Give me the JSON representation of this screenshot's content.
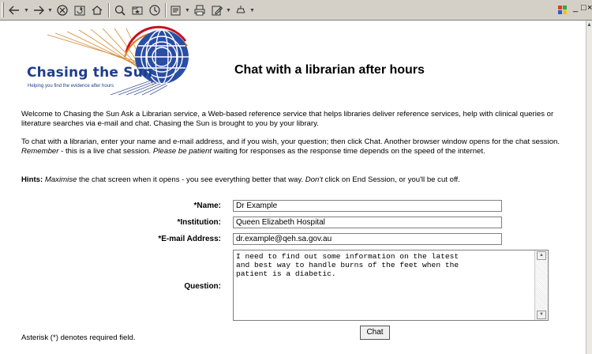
{
  "toolbar": {
    "icons": [
      "back-icon",
      "forward-icon",
      "stop-icon",
      "refresh-icon",
      "home-icon",
      "search-icon",
      "favorites-icon",
      "history-icon",
      "mail-icon",
      "print-icon",
      "edit-icon",
      "discuss-icon"
    ],
    "window_controls": [
      "_",
      "□",
      "×"
    ]
  },
  "logo": {
    "title": "Chasing the Sun",
    "tagline": "Helping you find the evidence after hours"
  },
  "page_title": "Chat with a librarian after hours",
  "intro": {
    "p1": "Welcome to Chasing the Sun Ask a Librarian service, a Web-based reference service that helps libraries deliver reference services, help with clinical queries or literature searches via e-mail and chat. Chasing the Sun is brought to you by your library.",
    "p2_a": "To chat with a librarian, enter your name and e-mail address, and if you wish, your question; then click Chat. Another browser window opens for the chat session. ",
    "p2_remember": "Remember",
    "p2_b": " - this is a live chat session. ",
    "p2_patient": "Please be patient",
    "p2_c": " waiting for responses as the response time depends on the speed of the internet."
  },
  "hints": {
    "label": "Hints:",
    "maximise": "Maximise",
    "text_a": " the chat screen when it opens - you see everything better that way. ",
    "dont": "Don't",
    "text_b": " click on End Session, or you'll be cut off."
  },
  "form": {
    "name_label": "*Name:",
    "name_value": "Dr Example",
    "institution_label": "*Institution:",
    "institution_value": "Queen Elizabeth Hospital",
    "email_label": "*E-mail Address:",
    "email_value": "dr.example@qeh.sa.gov.au",
    "question_label": "Question:",
    "question_value": "I need to find out some information on the latest\nand best way to handle burns of the feet when the\npatient is a diabetic.",
    "chat_button": "Chat",
    "required_note": "Asterisk (*) denotes required field."
  }
}
